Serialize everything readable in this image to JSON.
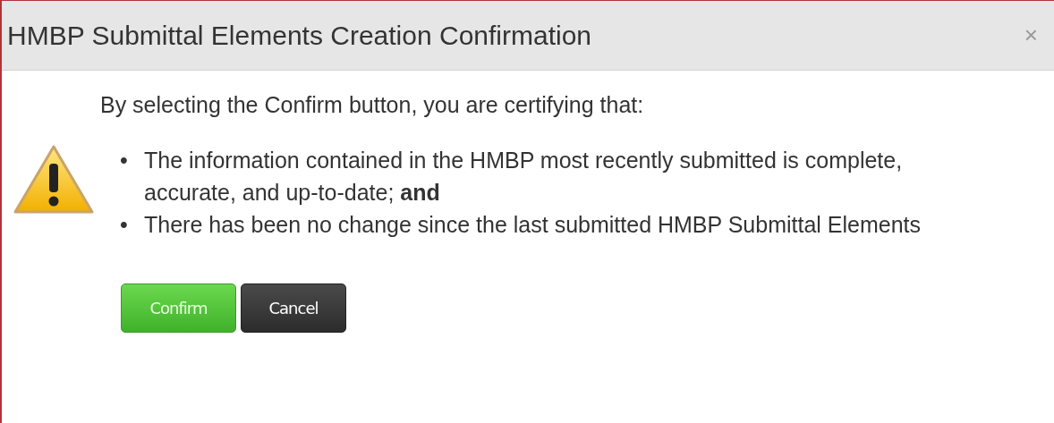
{
  "dialog": {
    "title": "HMBP Submittal Elements Creation Confirmation",
    "close": "×",
    "intro": "By selecting the Confirm button, you are certifying that:",
    "marker": "•",
    "points": [
      {
        "text": "The information contained in the HMBP most recently submitted is complete, accurate, and up-to-date; **and**"
      },
      {
        "text": "There has been no change since the last submitted HMBP Submittal Elements"
      }
    ],
    "buttons": [
      {
        "label": "Confirm",
        "kind": "primary"
      },
      {
        "label": "Cancel",
        "kind": "secondary"
      }
    ]
  }
}
